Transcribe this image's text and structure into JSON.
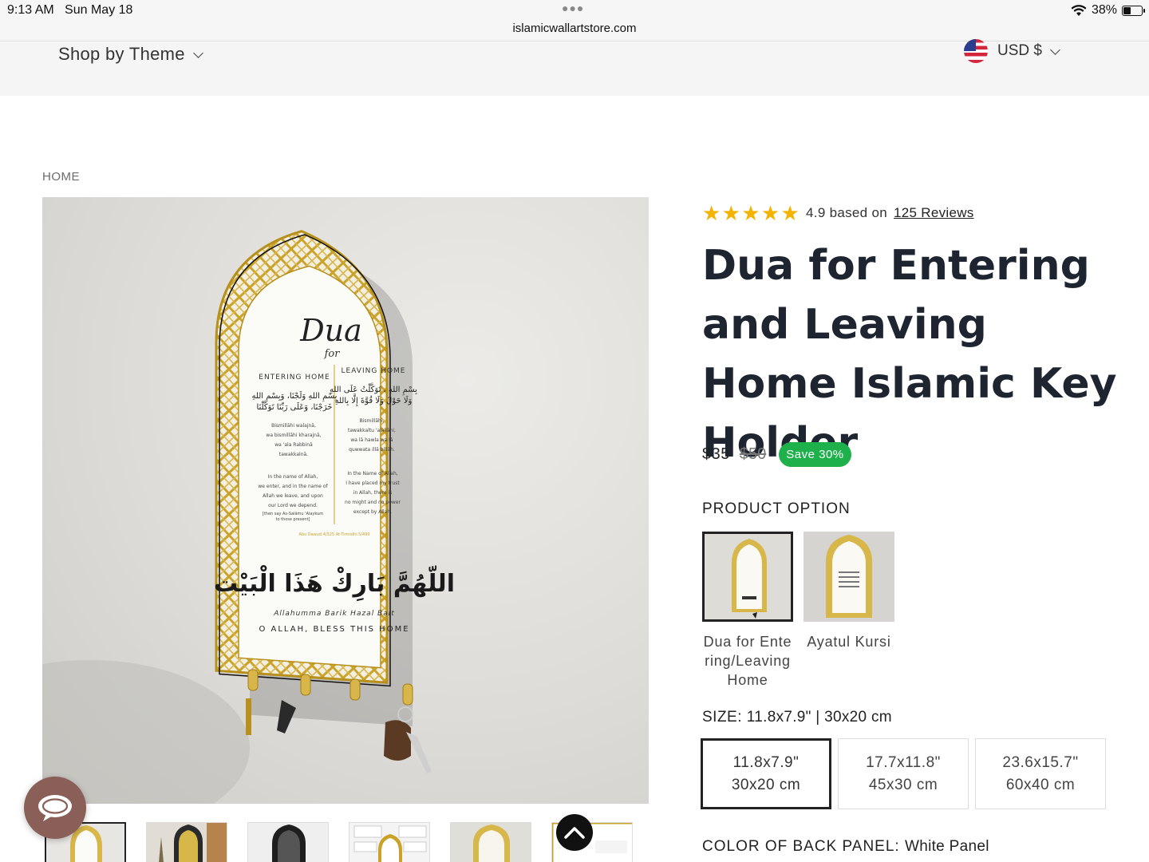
{
  "status_bar": {
    "time": "9:13 AM",
    "date": "Sun May 18",
    "url": "islamicwallartstore.com",
    "battery": "38%",
    "battery_level": 0.38
  },
  "header": {
    "nav_theme": "Shop by Theme",
    "currency": "USD $"
  },
  "breadcrumb": "HOME",
  "product_image": {
    "title_script": "Dua",
    "title_sub": "for",
    "left_heading": "ENTERING HOME",
    "right_heading": "LEAVING HOME",
    "left_arabic_1": "بِسْمِ اللهِ وَلَجْنَا، وَبِسْمِ اللهِ",
    "left_arabic_2": "خَرَجْنَا، وَعَلَى رَبِّنَا تَوَكَّلْنَا",
    "right_arabic_1": "بِسْمِ اللهِ ، تَوَكَّلْتُ عَلَى اللهِ",
    "right_arabic_2": "وَلَا حَوْلَ وَلَا قُوَّةَ إِلَّا بِاللهِ",
    "left_translit": [
      "Bismillāhi walajnā,",
      "wa bismillāhi kharajnā,",
      "wa 'ala Rabbinā",
      "tawakkalnā."
    ],
    "right_translit": [
      "Bismillāhi,",
      "tawakkaltu 'alallāhi,",
      "wa lā hawla wa lā",
      "quwwata illā billāh."
    ],
    "left_meaning": [
      "In the name of Allah,",
      "we enter, and in the name of",
      "Allah we leave, and upon",
      "our Lord we depend.",
      "[then say As-Salāmu 'Alaykum",
      "to those present]"
    ],
    "right_meaning": [
      "In the Name of Allah,",
      "I have placed my trust",
      "in Allah, there is",
      "no might and no power",
      "except by Allah."
    ],
    "refs": "Abu Dawud 4/325   At-Tirmidhi 5/490",
    "arabic_bless": "اللّهُمَّ بَارِكْ هَذَا الْبَيْت",
    "bless_translit": "Allahumma Barik Hazal Bait",
    "bless_english": "O ALLAH, BLESS THIS HOME"
  },
  "product": {
    "rating_value": 4.9,
    "rating_text": "4.9 based on",
    "reviews_link": "125 Reviews",
    "title": "Dua for Entering and Leaving Home Islamic Key Holder",
    "price": "$35",
    "compare_price": "$50",
    "save_badge": "Save 30%",
    "option_label": "PRODUCT OPTION",
    "options": [
      {
        "name": "Dua for Entering/Leaving Home",
        "selected": true
      },
      {
        "name": "Ayatul Kursi",
        "selected": false
      }
    ],
    "size_label": "SIZE:",
    "size_value": "11.8x7.9\" | 30x20 cm",
    "sizes": [
      {
        "in": "11.8x7.9\"",
        "cm": "30x20 cm",
        "selected": true
      },
      {
        "in": "17.7x11.8\"",
        "cm": "45x30 cm",
        "selected": false
      },
      {
        "in": "23.6x15.7\"",
        "cm": "60x40 cm",
        "selected": false
      }
    ],
    "color_label": "COLOR OF BACK PANEL:",
    "color_value": "White Panel"
  },
  "colors": {
    "star": "#f5b301",
    "save_badge": "#1eb14b",
    "chat_button": "#8a5f57",
    "gold": "#c9a227",
    "title_text": "#1f2530"
  },
  "icons": [
    "wifi-icon",
    "battery-icon",
    "chevron-down-icon",
    "us-flag-icon",
    "star-icon",
    "chat-icon",
    "arrow-up-icon"
  ]
}
